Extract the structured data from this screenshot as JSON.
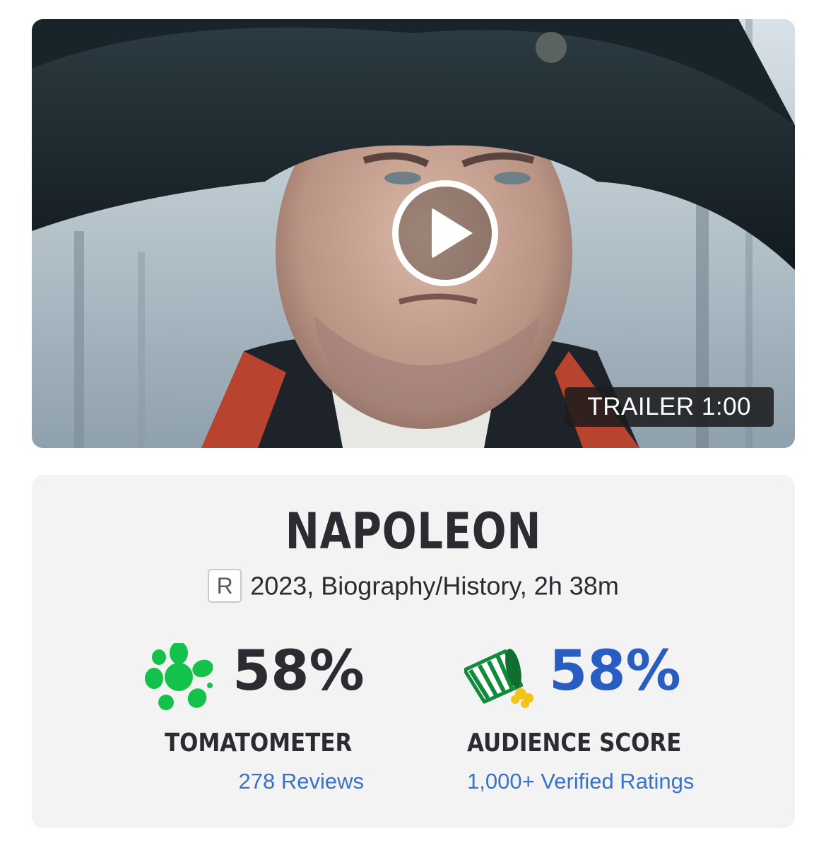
{
  "trailer": {
    "badge": "TRAILER 1:00"
  },
  "movie": {
    "title": "NAPOLEON",
    "rating": "R",
    "details": "2023, Biography/History, 2h 38m"
  },
  "scores": {
    "tomatometer": {
      "value": "58%",
      "label": "TOMATOMETER",
      "link": "278 Reviews",
      "icon": "green-splat-icon",
      "color": "#2a2c32",
      "icon_color": "#14c14a"
    },
    "audience": {
      "value": "58%",
      "label": "AUDIENCE SCORE",
      "link": "1,000+ Verified Ratings",
      "icon": "tipped-popcorn-icon",
      "color": "#2a5dc2",
      "icon_color": "#128a3c"
    }
  },
  "colors": {
    "link": "#3a72c9",
    "card_background": "#f3f3f3",
    "text": "#2a2c32"
  }
}
